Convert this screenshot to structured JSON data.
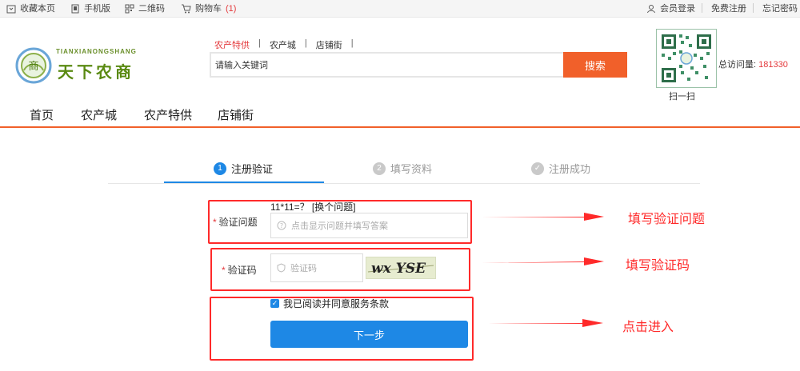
{
  "topbar": {
    "bookmark": "收藏本页",
    "mobile": "手机版",
    "qrcode": "二维码",
    "cart": "购物车",
    "cart_count": "(1)",
    "login": "会员登录",
    "register": "免费注册",
    "forgot": "忘记密码"
  },
  "logo": {
    "pinyin": "TIANXIANONGSHANG",
    "text": "天下农商"
  },
  "search": {
    "tabs": [
      "农产特供",
      "农产城",
      "店铺街"
    ],
    "active_tab": 0,
    "placeholder": "请输入关键词",
    "button": "搜索"
  },
  "qr": {
    "caption": "扫一扫"
  },
  "visits": {
    "label": "总访问量:",
    "count": "181330"
  },
  "nav": {
    "items": [
      "首页",
      "农产城",
      "农产特供",
      "店铺街"
    ]
  },
  "steps": [
    {
      "num": "1",
      "label": "注册验证",
      "state": "active"
    },
    {
      "num": "2",
      "label": "填写资料",
      "state": "inactive"
    },
    {
      "num": "✓",
      "label": "注册成功",
      "state": "inactive"
    }
  ],
  "form": {
    "question_label": "验证问题",
    "question_text": "11*11=？ [换个问题]",
    "question_placeholder": "点击显示问题并填写答案",
    "captcha_label": "验证码",
    "captcha_placeholder": "验证码",
    "captcha_image_text": "wx YSE",
    "agree_text": "我已阅读并同意服务条款",
    "next_button": "下一步"
  },
  "annotations": {
    "question": "填写验证问题",
    "captcha": "填写验证码",
    "next": "点击进入"
  },
  "colors": {
    "accent": "#f1602a",
    "primary": "#1e88e5",
    "annotation": "#ff2a2a",
    "price_red": "#e4393c"
  }
}
